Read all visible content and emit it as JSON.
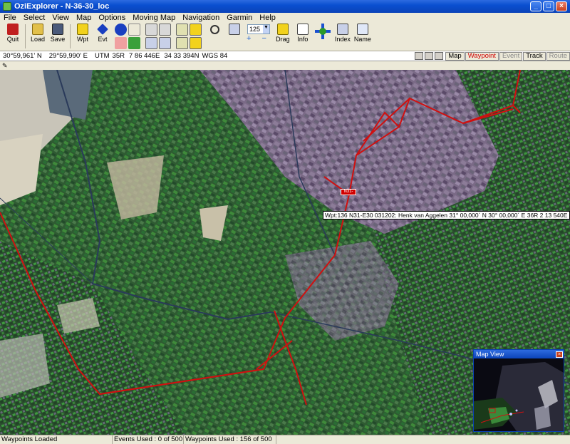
{
  "window": {
    "title": "OziExplorer - N-36-30_loc",
    "min": "_",
    "max": "□",
    "close": "×"
  },
  "menu": [
    "File",
    "Select",
    "View",
    "Map",
    "Options",
    "Moving Map",
    "Navigation",
    "Garmin",
    "Help"
  ],
  "toolbar": {
    "quit": "Quit",
    "load": "Load",
    "save": "Save",
    "wpt": "Wpt",
    "evt": "Evt",
    "drag": "Drag",
    "info": "Info",
    "index": "Index",
    "name": "Name",
    "zoom_value": "125",
    "zoom_pm": "+ −"
  },
  "coords": {
    "lat": "30°59,961' N",
    "lon": "29°59,990' E",
    "utm_label": "UTM",
    "zone": "35R",
    "easting": "7 86 446E",
    "northing": "34 33 394N",
    "datum": "WGS 84"
  },
  "modes": [
    "Map",
    "Waypoint",
    "Event",
    "Track",
    "Route"
  ],
  "waypoint": {
    "flag": "N31-E30",
    "tooltip": "Wpt:136  N31-E30  031202: Henk van Aggelen      31° 00,000´ N      30° 00,000´ E   36R    2 13 540E    34 33 467N"
  },
  "mapview": {
    "title": "Map View",
    "close": "×"
  },
  "status": {
    "msg": "Waypoints Loaded",
    "events": "Events Used : 0 of 500",
    "waypoints": "Waypoints Used : 156 of 500"
  },
  "colors": {
    "title_bar": "#0a4fd0",
    "track": "#d01010",
    "active_mode": "#d00000"
  }
}
